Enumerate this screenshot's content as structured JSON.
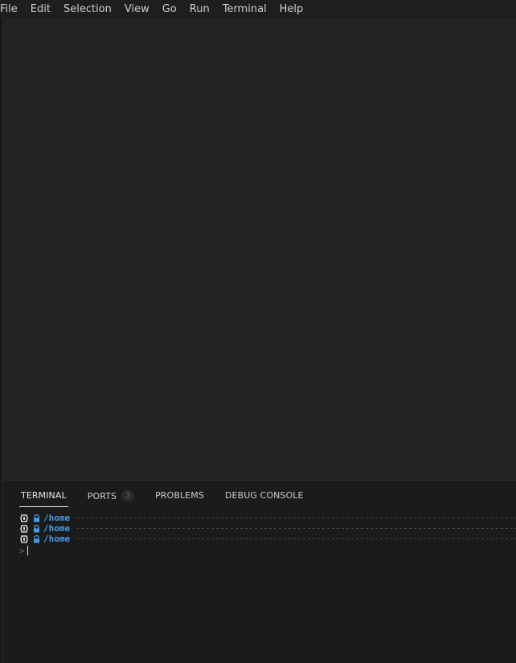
{
  "menubar": {
    "items": [
      "File",
      "Edit",
      "Selection",
      "View",
      "Go",
      "Run",
      "Terminal",
      "Help"
    ]
  },
  "panel": {
    "tabs": [
      {
        "label": "TERMINAL",
        "active": true
      },
      {
        "label": "PORTS",
        "badge": "3"
      },
      {
        "label": "PROBLEMS"
      },
      {
        "label": "DEBUG CONSOLE"
      }
    ]
  },
  "terminal": {
    "lines": [
      {
        "os_icon": "linux-penguin-icon",
        "lock_icon": "lock-icon",
        "path": "/home"
      },
      {
        "os_icon": "linux-penguin-icon",
        "lock_icon": "lock-icon",
        "path": "/home"
      },
      {
        "os_icon": "linux-penguin-icon",
        "lock_icon": "lock-icon",
        "path": "/home"
      }
    ],
    "prompt_symbol": ">"
  },
  "colors": {
    "background": "#1e1e1e",
    "editor": "#232323",
    "panel": "#1b1b1b",
    "path": "#4a9ce6",
    "text": "#cccccc"
  }
}
